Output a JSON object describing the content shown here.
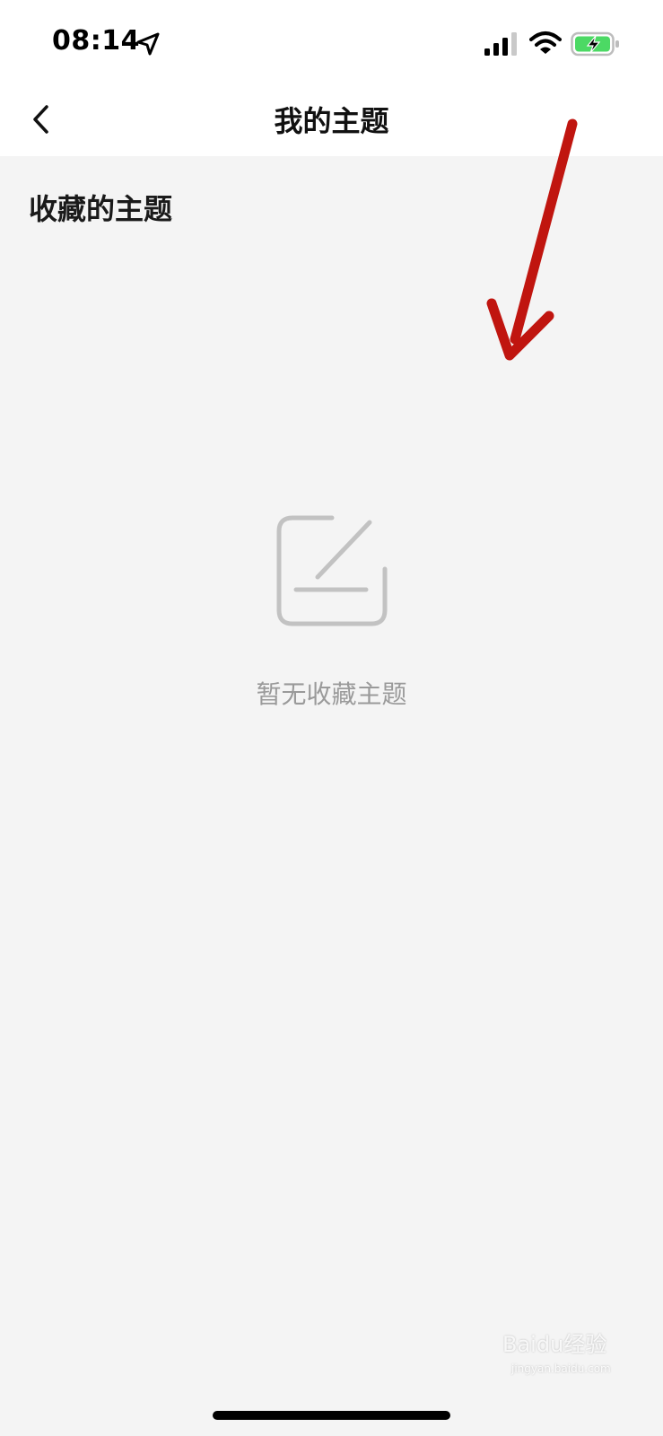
{
  "status_bar": {
    "time": "08:14",
    "icons": [
      "location-arrow-icon",
      "cellular-signal-icon",
      "wifi-icon",
      "battery-charging-icon"
    ],
    "battery_color": "#4cd964"
  },
  "nav": {
    "title": "我的主题",
    "back_icon": "chevron-left-icon"
  },
  "content": {
    "section_title": "收藏的主题",
    "empty_state": {
      "icon": "edit-square-icon",
      "message": "暂无收藏主题"
    }
  },
  "annotation": {
    "arrow_color": "#c0150f"
  },
  "watermark": {
    "text": "Baidu经验",
    "sub": "jingyan.baidu.com"
  }
}
